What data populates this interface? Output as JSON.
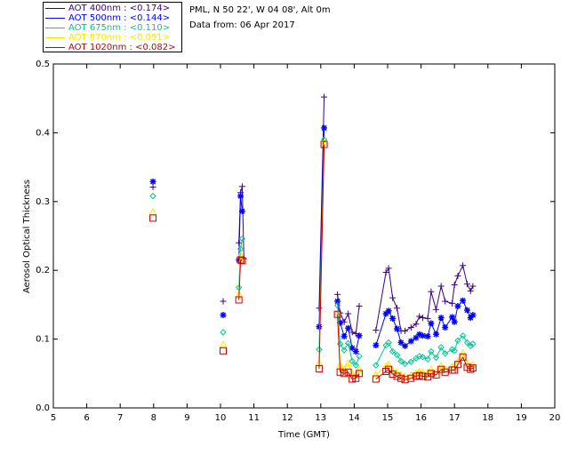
{
  "header": {
    "location": "PML, N 50 22', W 04 08', Alt 0m",
    "date": "Data from: 06 Apr 2017"
  },
  "legend": [
    {
      "label": "AOT  400nm : <0.174>",
      "color": "#3c0082"
    },
    {
      "label": "AOT  500nm : <0.144>",
      "color": "#0000ff"
    },
    {
      "label": "AOT  675nm : <0.110>",
      "color": "#00c896"
    },
    {
      "label": "AOT  870nm : <0.091>",
      "color": "#ffe600"
    },
    {
      "label": "AOT 1020nm : <0.082>",
      "color": "#c80000"
    }
  ],
  "chart_data": {
    "type": "line",
    "xlabel": "Time (GMT)",
    "ylabel": "Aerosol Optical Thickness",
    "xlim": [
      5,
      20
    ],
    "ylim": [
      0,
      0.5
    ],
    "xticks": [
      "5",
      "6",
      "7",
      "8",
      "9",
      "10",
      "11",
      "12",
      "13",
      "14",
      "15",
      "16",
      "17",
      "18",
      "19",
      "20"
    ],
    "yticks": [
      "0.0",
      "0.1",
      "0.2",
      "0.3",
      "0.4",
      "0.5"
    ],
    "series": [
      {
        "name": "AOT  400nm",
        "color": "#3c0082",
        "marker": "plus",
        "points": [
          [
            7.98,
            0.321
          ],
          [
            10.08,
            0.155
          ],
          [
            10.55,
            0.24
          ],
          [
            10.6,
            0.313
          ],
          [
            10.65,
            0.322
          ],
          [
            10.7,
            0.217
          ],
          [
            12.95,
            0.145
          ],
          [
            13.1,
            0.452
          ],
          [
            13.5,
            0.165
          ],
          [
            13.58,
            0.138
          ],
          [
            13.7,
            0.125
          ],
          [
            13.82,
            0.137
          ],
          [
            13.94,
            0.11
          ],
          [
            14.05,
            0.108
          ],
          [
            14.15,
            0.148
          ],
          [
            14.65,
            0.113
          ],
          [
            14.95,
            0.197
          ],
          [
            15.03,
            0.203
          ],
          [
            15.15,
            0.16
          ],
          [
            15.28,
            0.145
          ],
          [
            15.4,
            0.112
          ],
          [
            15.52,
            0.112
          ],
          [
            15.7,
            0.117
          ],
          [
            15.85,
            0.122
          ],
          [
            15.95,
            0.133
          ],
          [
            16.05,
            0.131
          ],
          [
            16.2,
            0.13
          ],
          [
            16.3,
            0.169
          ],
          [
            16.45,
            0.143
          ],
          [
            16.6,
            0.177
          ],
          [
            16.72,
            0.155
          ],
          [
            16.93,
            0.152
          ],
          [
            17.0,
            0.179
          ],
          [
            17.1,
            0.192
          ],
          [
            17.25,
            0.207
          ],
          [
            17.38,
            0.18
          ],
          [
            17.48,
            0.17
          ],
          [
            17.55,
            0.177
          ]
        ]
      },
      {
        "name": "AOT  500nm",
        "color": "#0000ff",
        "marker": "star",
        "points": [
          [
            7.98,
            0.329
          ],
          [
            10.08,
            0.135
          ],
          [
            10.55,
            0.215
          ],
          [
            10.6,
            0.308
          ],
          [
            10.65,
            0.286
          ],
          [
            12.95,
            0.118
          ],
          [
            13.1,
            0.407
          ],
          [
            13.5,
            0.155
          ],
          [
            13.58,
            0.124
          ],
          [
            13.7,
            0.104
          ],
          [
            13.82,
            0.116
          ],
          [
            13.94,
            0.087
          ],
          [
            14.05,
            0.082
          ],
          [
            14.15,
            0.105
          ],
          [
            14.65,
            0.091
          ],
          [
            14.95,
            0.137
          ],
          [
            15.03,
            0.141
          ],
          [
            15.15,
            0.13
          ],
          [
            15.28,
            0.115
          ],
          [
            15.4,
            0.095
          ],
          [
            15.52,
            0.09
          ],
          [
            15.7,
            0.097
          ],
          [
            15.85,
            0.102
          ],
          [
            15.95,
            0.107
          ],
          [
            16.05,
            0.105
          ],
          [
            16.2,
            0.104
          ],
          [
            16.3,
            0.123
          ],
          [
            16.45,
            0.107
          ],
          [
            16.6,
            0.131
          ],
          [
            16.72,
            0.117
          ],
          [
            16.93,
            0.132
          ],
          [
            17.0,
            0.125
          ],
          [
            17.1,
            0.148
          ],
          [
            17.25,
            0.156
          ],
          [
            17.38,
            0.142
          ],
          [
            17.48,
            0.131
          ],
          [
            17.55,
            0.135
          ]
        ]
      },
      {
        "name": "AOT  675nm",
        "color": "#00c896",
        "marker": "diamond",
        "points": [
          [
            7.98,
            0.308
          ],
          [
            10.08,
            0.11
          ],
          [
            10.55,
            0.175
          ],
          [
            10.6,
            0.231
          ],
          [
            10.65,
            0.246
          ],
          [
            12.95,
            0.085
          ],
          [
            13.1,
            0.39
          ],
          [
            13.5,
            0.149
          ],
          [
            13.58,
            0.093
          ],
          [
            13.7,
            0.084
          ],
          [
            13.82,
            0.094
          ],
          [
            13.94,
            0.068
          ],
          [
            14.05,
            0.062
          ],
          [
            14.15,
            0.075
          ],
          [
            14.65,
            0.062
          ],
          [
            14.95,
            0.091
          ],
          [
            15.03,
            0.095
          ],
          [
            15.15,
            0.082
          ],
          [
            15.28,
            0.077
          ],
          [
            15.4,
            0.068
          ],
          [
            15.52,
            0.064
          ],
          [
            15.7,
            0.067
          ],
          [
            15.85,
            0.072
          ],
          [
            15.95,
            0.075
          ],
          [
            16.05,
            0.074
          ],
          [
            16.2,
            0.071
          ],
          [
            16.3,
            0.082
          ],
          [
            16.45,
            0.073
          ],
          [
            16.6,
            0.088
          ],
          [
            16.72,
            0.079
          ],
          [
            16.93,
            0.085
          ],
          [
            17.0,
            0.083
          ],
          [
            17.1,
            0.098
          ],
          [
            17.25,
            0.105
          ],
          [
            17.38,
            0.095
          ],
          [
            17.48,
            0.09
          ],
          [
            17.55,
            0.093
          ]
        ]
      },
      {
        "name": "AOT  870nm",
        "color": "#ffe600",
        "marker": "triangle",
        "points": [
          [
            7.98,
            0.285
          ],
          [
            10.08,
            0.092
          ],
          [
            10.55,
            0.165
          ],
          [
            10.6,
            0.222
          ],
          [
            10.65,
            0.216
          ],
          [
            12.95,
            0.065
          ],
          [
            13.1,
            0.386
          ],
          [
            13.5,
            0.138
          ],
          [
            13.58,
            0.062
          ],
          [
            13.7,
            0.056
          ],
          [
            13.82,
            0.065
          ],
          [
            13.94,
            0.05
          ],
          [
            14.05,
            0.048
          ],
          [
            14.15,
            0.056
          ],
          [
            14.65,
            0.048
          ],
          [
            14.95,
            0.061
          ],
          [
            15.03,
            0.063
          ],
          [
            15.15,
            0.055
          ],
          [
            15.28,
            0.052
          ],
          [
            15.4,
            0.048
          ],
          [
            15.52,
            0.046
          ],
          [
            15.7,
            0.048
          ],
          [
            15.85,
            0.051
          ],
          [
            15.95,
            0.053
          ],
          [
            16.05,
            0.052
          ],
          [
            16.2,
            0.051
          ],
          [
            16.3,
            0.056
          ],
          [
            16.45,
            0.052
          ],
          [
            16.6,
            0.061
          ],
          [
            16.72,
            0.057
          ],
          [
            16.93,
            0.06
          ],
          [
            17.0,
            0.06
          ],
          [
            17.1,
            0.068
          ],
          [
            17.25,
            0.08
          ],
          [
            17.38,
            0.065
          ],
          [
            17.48,
            0.061
          ],
          [
            17.55,
            0.063
          ]
        ]
      },
      {
        "name": "AOT 1020nm",
        "color": "#c80000",
        "marker": "square",
        "points": [
          [
            7.98,
            0.276
          ],
          [
            10.08,
            0.083
          ],
          [
            10.55,
            0.157
          ],
          [
            10.6,
            0.215
          ],
          [
            10.65,
            0.214
          ],
          [
            12.95,
            0.057
          ],
          [
            13.1,
            0.383
          ],
          [
            13.5,
            0.136
          ],
          [
            13.58,
            0.052
          ],
          [
            13.7,
            0.05
          ],
          [
            13.82,
            0.052
          ],
          [
            13.94,
            0.042
          ],
          [
            14.05,
            0.043
          ],
          [
            14.15,
            0.05
          ],
          [
            14.65,
            0.042
          ],
          [
            14.95,
            0.053
          ],
          [
            15.03,
            0.056
          ],
          [
            15.15,
            0.049
          ],
          [
            15.28,
            0.046
          ],
          [
            15.4,
            0.043
          ],
          [
            15.52,
            0.041
          ],
          [
            15.7,
            0.043
          ],
          [
            15.85,
            0.046
          ],
          [
            15.95,
            0.047
          ],
          [
            16.05,
            0.046
          ],
          [
            16.2,
            0.045
          ],
          [
            16.3,
            0.05
          ],
          [
            16.45,
            0.048
          ],
          [
            16.6,
            0.056
          ],
          [
            16.72,
            0.052
          ],
          [
            16.93,
            0.055
          ],
          [
            17.0,
            0.055
          ],
          [
            17.1,
            0.063
          ],
          [
            17.25,
            0.074
          ],
          [
            17.38,
            0.059
          ],
          [
            17.48,
            0.056
          ],
          [
            17.55,
            0.058
          ]
        ]
      }
    ]
  }
}
